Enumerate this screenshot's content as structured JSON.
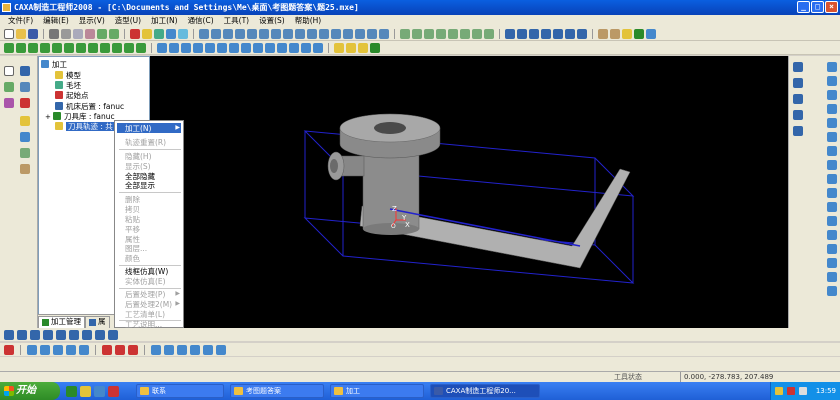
{
  "window": {
    "title": "CAXA制造工程师2008 - [C:\\Documents and Settings\\Me\\桌面\\考图题答案\\题25.mxe]",
    "controls": [
      "_",
      "□",
      "×"
    ]
  },
  "menubar": [
    "文件(F)",
    "编辑(E)",
    "显示(V)",
    "造型(U)",
    "加工(N)",
    "通信(C)",
    "工具(T)",
    "设置(S)",
    "帮助(H)"
  ],
  "tree": {
    "root": "加工",
    "items": [
      {
        "label": "模型"
      },
      {
        "label": "毛坯"
      },
      {
        "label": "起始点"
      },
      {
        "label": "机床后置 : fanuc"
      },
      {
        "label": "刀具库 : fanuc"
      },
      {
        "label": "刀具轨迹 : 共"
      }
    ]
  },
  "panel_tabs": [
    "加工管理",
    "属"
  ],
  "context_menu": {
    "items": [
      {
        "label": "加工(N)",
        "enabled": true,
        "submenu": true
      },
      {
        "label": "轨迹重置(R)",
        "enabled": false
      },
      {
        "label": "隐藏(H)",
        "enabled": false
      },
      {
        "label": "显示(S)",
        "enabled": false
      },
      {
        "label": "全部隐藏",
        "enabled": true
      },
      {
        "label": "全部显示",
        "enabled": true
      },
      {
        "label": "删除",
        "enabled": false
      },
      {
        "label": "拷贝",
        "enabled": false
      },
      {
        "label": "粘贴",
        "enabled": false
      },
      {
        "label": "平移",
        "enabled": false
      },
      {
        "label": "属性",
        "enabled": false
      },
      {
        "label": "图层...",
        "enabled": false
      },
      {
        "label": "颜色",
        "enabled": false
      },
      {
        "label": "线框仿真(W)",
        "enabled": true
      },
      {
        "label": "实体仿真(E)",
        "enabled": false
      },
      {
        "label": "后置处理(P)",
        "enabled": false,
        "submenu": true
      },
      {
        "label": "后置处理2(M)",
        "enabled": false,
        "submenu": true
      },
      {
        "label": "工艺清单(L)",
        "enabled": false
      },
      {
        "label": "工艺说明...",
        "enabled": false
      }
    ]
  },
  "viewport": {
    "axes": {
      "z": "Z",
      "y": "Y",
      "x": "X",
      "origin": "O"
    },
    "background": "#000000",
    "model_color": "#9a9a9a",
    "box_color": "#2222cc"
  },
  "statusbar": {
    "status": "工具状态",
    "coords": "0.000, -278.783, 207.489"
  },
  "taskbar": {
    "start": "开始",
    "tasks": [
      {
        "label": "联系"
      },
      {
        "label": "考图题答案"
      },
      {
        "label": "加工"
      },
      {
        "label": "CAXA制造工程师20..."
      }
    ],
    "clock": "13:59"
  }
}
